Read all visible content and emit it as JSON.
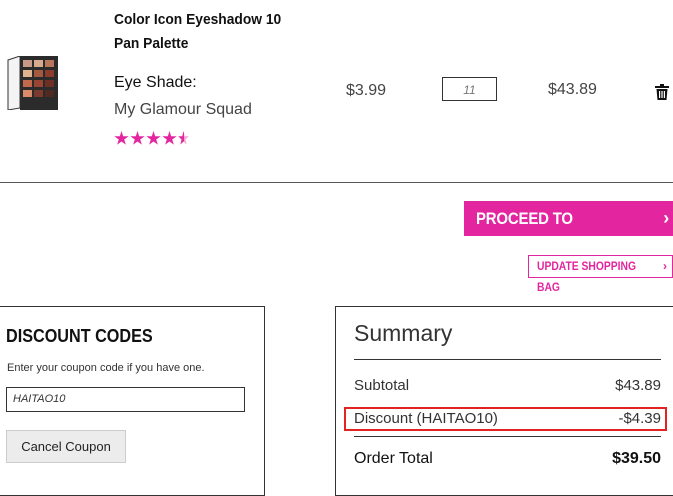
{
  "product": {
    "name": "Color Icon Eyeshadow 10 Pan Palette",
    "option_label": "Eye Shade:",
    "option_value": "My Glamour Squad",
    "rating": 4.5,
    "unit_price": "$3.99",
    "quantity": "11",
    "row_total": "$43.89",
    "thumbnail_icon": "eyeshadow-palette-image",
    "remove_icon": "trash-icon"
  },
  "actions": {
    "checkout_label": "PROCEED TO CHECKOUT",
    "update_label": "UPDATE SHOPPING BAG"
  },
  "discount": {
    "title": "DISCOUNT CODES",
    "help_text": "Enter your coupon code if you have one.",
    "coupon_value": "HAITAO10",
    "cancel_label": "Cancel Coupon"
  },
  "summary": {
    "title": "Summary",
    "subtotal_label": "Subtotal",
    "subtotal_value": "$43.89",
    "discount_label": "Discount (HAITAO10)",
    "discount_value": "-$4.39",
    "total_label": "Order Total",
    "total_value": "$39.50"
  },
  "colors": {
    "accent": "#e3259f",
    "highlight": "#e32222"
  }
}
